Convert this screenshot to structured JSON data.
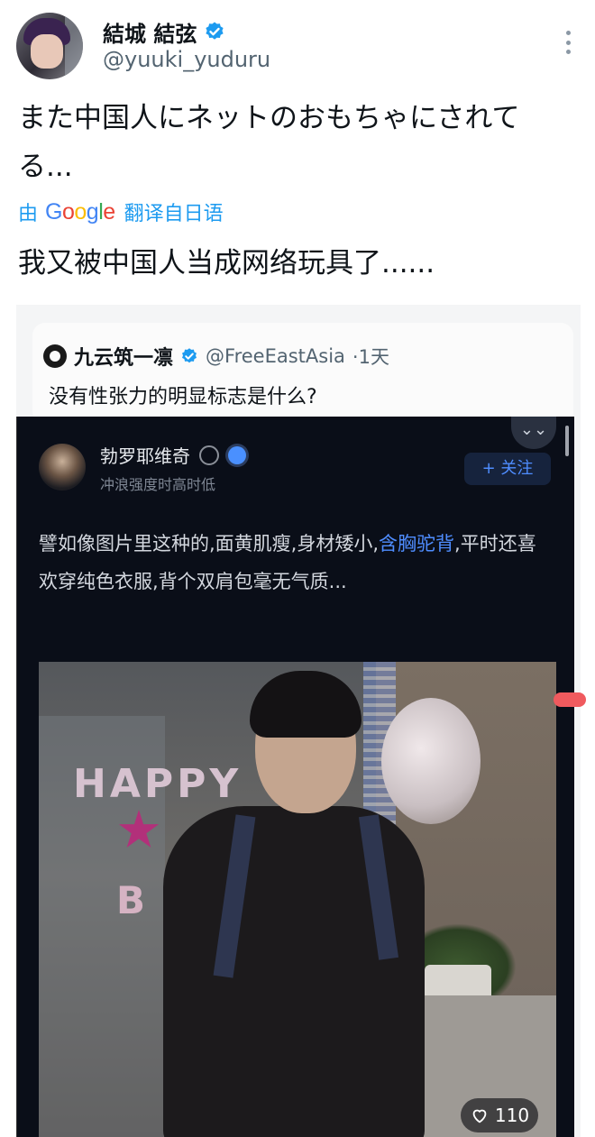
{
  "tweet": {
    "display_name": "結城 結弦",
    "handle": "@yuuki_yuduru",
    "text_line1": "また中国人にネットのおもちゃにされて",
    "text_line2": "る...",
    "translate_prefix": "由",
    "translate_brand": "Google",
    "translate_suffix": "翻译自日语",
    "translated_text": "我又被中国人当成网络玩具了......"
  },
  "quote": {
    "name": "九云筑一凛",
    "handle": "@FreeEastAsia",
    "time": "·1天",
    "question": "没有性张力的明显标志是什么?"
  },
  "answer": {
    "collapse_glyph": "⌄⌄",
    "author": "勃罗耶维奇",
    "meta": "冲浪强度时高时低",
    "follow_label": "+ 关注",
    "text_a": "譬如像图片里这种的,面黄肌瘦,身材矮小,",
    "text_link": "含胸驼背",
    "text_b": ",平时还喜欢穿纯色衣服,背个双肩包毫无气质...",
    "photo_letters_top": "HAPPY",
    "photo_letters_bottom": "B",
    "likes": "110"
  },
  "colors": {
    "accent": "#1d9bf0",
    "verified": "#1d9bf0",
    "dark_bg": "#0a0e18",
    "link_blue": "#4f8dff",
    "marker": "#f05a5e"
  },
  "icons": [
    "verified-icon",
    "more-icon",
    "quote-logo-icon",
    "badge-icon",
    "heart-icon",
    "collapse-icon"
  ]
}
